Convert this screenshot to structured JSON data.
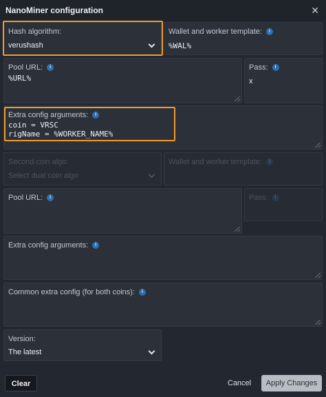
{
  "dialog": {
    "title": "NanoMiner configuration",
    "close_glyph": "✕"
  },
  "primary": {
    "hash_algorithm": {
      "label": "Hash algorithm:",
      "value": "verushash"
    },
    "wallet": {
      "label": "Wallet and worker template:",
      "value": "%WAL%"
    },
    "pool_url": {
      "label": "Pool URL:",
      "value": "%URL%"
    },
    "pass": {
      "label": "Pass:",
      "value": "x"
    },
    "extra": {
      "label": "Extra config arguments:",
      "line1": "coin = VRSC",
      "line2": "rigName = %WORKER_NAME%"
    }
  },
  "dual": {
    "second_algo": {
      "label": "Second coin algo:",
      "placeholder": "Select dual coin algo"
    },
    "wallet": {
      "label": "Wallet and worker template:"
    },
    "pool_url": {
      "label": "Pool URL:"
    },
    "pass": {
      "label": "Pass:"
    },
    "extra": {
      "label": "Extra config arguments:"
    }
  },
  "common_extra": {
    "label": "Common extra config (for both coins):"
  },
  "version": {
    "label": "Version:",
    "value": "The latest"
  },
  "footer": {
    "clear": "Clear",
    "cancel": "Cancel",
    "apply": "Apply Changes"
  },
  "icons": {
    "info": "i",
    "info_icon_name": "info-icon",
    "chevron": "chevron-down-icon",
    "close": "close-icon"
  },
  "colors": {
    "background": "#23272f",
    "field": "#2b3039",
    "highlight": "#f39c2b",
    "info_badge": "#2d6fb0",
    "apply_button": "#b8bcc3"
  }
}
